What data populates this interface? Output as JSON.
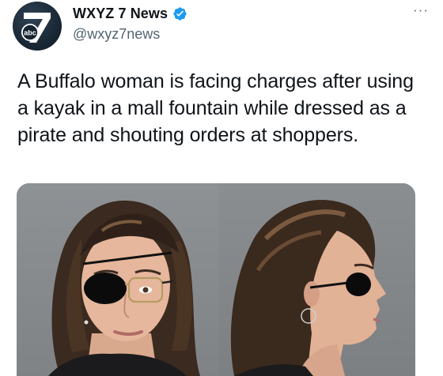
{
  "tweet": {
    "author": {
      "display_name": "WXYZ 7 News",
      "handle": "@wxyz7news",
      "avatar_icon": "wxyz-abc-7-logo",
      "avatar_logo_text": "abc",
      "verified_icon": "verified-badge-icon",
      "verified_color": "#1d9bf0"
    },
    "more_icon": "more-options-icon",
    "more_glyph": "···",
    "text": "A Buffalo woman is facing charges after using a kayak in a mall fountain while dressed as a pirate and shouting orders at shoppers.",
    "media": [
      {
        "icon": "mugshot-front-photo"
      },
      {
        "icon": "mugshot-profile-photo"
      }
    ]
  }
}
